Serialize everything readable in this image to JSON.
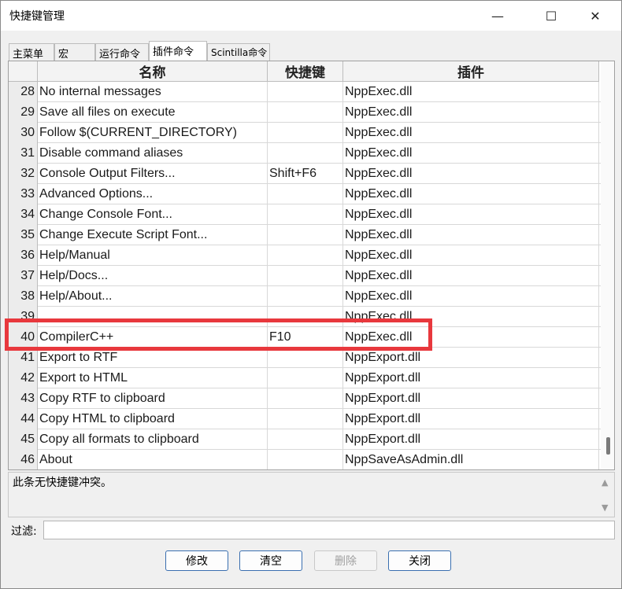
{
  "window": {
    "title": "快捷键管理",
    "min_glyph": "—",
    "max_glyph": "☐",
    "close_glyph": "✕"
  },
  "tabs": [
    {
      "label": "主菜单"
    },
    {
      "label": "宏"
    },
    {
      "label": "运行命令"
    },
    {
      "label": "插件命令",
      "active": true
    },
    {
      "label": "Scintilla命令"
    }
  ],
  "table": {
    "headers": {
      "name": "名称",
      "shortcut": "快捷键",
      "plugin": "插件"
    },
    "rows": [
      {
        "num": "28",
        "name": "No internal messages",
        "shortcut": "",
        "plugin": "NppExec.dll"
      },
      {
        "num": "29",
        "name": "Save all files on execute",
        "shortcut": "",
        "plugin": "NppExec.dll"
      },
      {
        "num": "30",
        "name": "Follow $(CURRENT_DIRECTORY)",
        "shortcut": "",
        "plugin": "NppExec.dll"
      },
      {
        "num": "31",
        "name": "Disable command aliases",
        "shortcut": "",
        "plugin": "NppExec.dll"
      },
      {
        "num": "32",
        "name": "Console Output Filters...",
        "shortcut": "Shift+F6",
        "plugin": "NppExec.dll"
      },
      {
        "num": "33",
        "name": "Advanced Options...",
        "shortcut": "",
        "plugin": "NppExec.dll"
      },
      {
        "num": "34",
        "name": "Change Console Font...",
        "shortcut": "",
        "plugin": "NppExec.dll"
      },
      {
        "num": "35",
        "name": "Change Execute Script Font...",
        "shortcut": "",
        "plugin": "NppExec.dll"
      },
      {
        "num": "36",
        "name": "Help/Manual",
        "shortcut": "",
        "plugin": "NppExec.dll"
      },
      {
        "num": "37",
        "name": "Help/Docs...",
        "shortcut": "",
        "plugin": "NppExec.dll"
      },
      {
        "num": "38",
        "name": "Help/About...",
        "shortcut": "",
        "plugin": "NppExec.dll"
      },
      {
        "num": "39",
        "name": "",
        "shortcut": "",
        "plugin": "NppExec.dll"
      },
      {
        "num": "40",
        "name": "CompilerC++",
        "shortcut": "F10",
        "plugin": "NppExec.dll"
      },
      {
        "num": "41",
        "name": "Export to RTF",
        "shortcut": "",
        "plugin": "NppExport.dll"
      },
      {
        "num": "42",
        "name": "Export to HTML",
        "shortcut": "",
        "plugin": "NppExport.dll"
      },
      {
        "num": "43",
        "name": "Copy RTF to clipboard",
        "shortcut": "",
        "plugin": "NppExport.dll"
      },
      {
        "num": "44",
        "name": "Copy HTML to clipboard",
        "shortcut": "",
        "plugin": "NppExport.dll"
      },
      {
        "num": "45",
        "name": "Copy all formats to clipboard",
        "shortcut": "",
        "plugin": "NppExport.dll"
      },
      {
        "num": "46",
        "name": "About",
        "shortcut": "",
        "plugin": "NppSaveAsAdmin.dll"
      }
    ]
  },
  "conflict": {
    "text": "此条无快捷键冲突。",
    "up_glyph": "▲",
    "down_glyph": "▼"
  },
  "filter": {
    "label": "过滤:",
    "value": ""
  },
  "buttons": {
    "modify": "修改",
    "clear": "清空",
    "delete": "删除",
    "close": "关闭"
  },
  "highlight_color": "#e8383d"
}
